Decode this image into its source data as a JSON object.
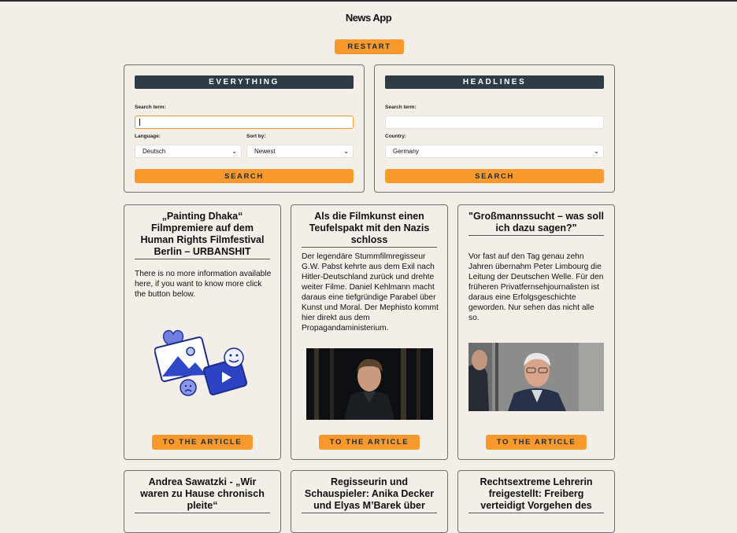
{
  "app": {
    "title": "News App",
    "restart_label": "RESTART"
  },
  "everything": {
    "heading": "EVERYTHING",
    "search_label": "Search term:",
    "search_value": "",
    "language_label": "Language:",
    "language_value": "Deutsch",
    "sort_label": "Sort by:",
    "sort_value": "Newest",
    "search_button": "SEARCH"
  },
  "headlines": {
    "heading": "HEADLINES",
    "search_label": "Search term:",
    "search_value": "",
    "country_label": "Country:",
    "country_value": "Germany",
    "search_button": "SEARCH"
  },
  "articles": [
    {
      "title": "„Painting Dhaka“ Filmpremiere auf dem Human Rights Filmfestival Berlin – URBANSHIT",
      "description": "There is no more information available here, if you want to know more click the button below.",
      "button": "TO THE ARTICLE",
      "image": "placeholder-illustration"
    },
    {
      "title": "Als die Filmkunst einen Teufelspakt mit den Nazis schloss",
      "description": "Der legendäre Stummfilmregisseur G.W. Pabst kehrte aus dem Exil nach Hitler-Deutschland zurück und drehte weiter Filme. Daniel Kehlmann macht daraus eine tiefgründige Parabel über Kunst und Moral. Der Mephisto kommt hier direkt aus dem Propagandaministerium.",
      "button": "TO THE ARTICLE",
      "image": "portrait-photo"
    },
    {
      "title": "\"Großmannssucht – was soll ich dazu sagen?\"",
      "description": "Vor fast auf den Tag genau zehn Jahren übernahm Peter Limbourg die Leitung der Deutschen Welle. Für den früheren Privatfernsehjournalisten ist daraus eine Erfolgsgeschichte geworden. Nur sehen das nicht alle so.",
      "button": "TO THE ARTICLE",
      "image": "interview-photo"
    },
    {
      "title": "Andrea Sawatzki - „Wir waren zu Hause chronisch pleite“"
    },
    {
      "title": "Regisseurin und Schauspieler: Anika Decker und Elyas M’Barek über"
    },
    {
      "title": "Rechtsextreme Lehrerin freigestellt: Freiberg verteidigt Vorgehen des"
    }
  ],
  "colors": {
    "accent": "#f7992c",
    "header_dark": "#2e3c47",
    "background": "#f3efe8"
  }
}
